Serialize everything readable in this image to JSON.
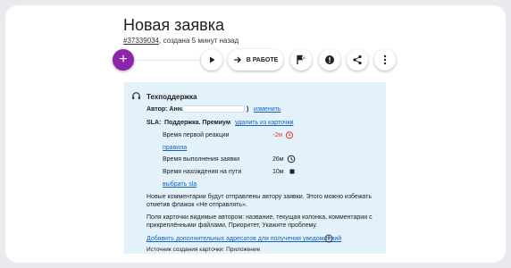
{
  "header": {
    "title": "Новая заявка",
    "ticket_id": "#37339034",
    "created": ", создана 5 минут назад"
  },
  "toolbar": {
    "fab_label": "+",
    "status_label": "В РАБОТЕ",
    "buttons": [
      "play-icon",
      "arrow-right-icon",
      "flag-icon",
      "alert-icon",
      "share-icon",
      "more-vert-icon"
    ]
  },
  "panel": {
    "queue_name": "Техподдержка",
    "author_label": "Автор: Анна (",
    "author_close": ")",
    "change_link": "изменить",
    "sla_label": "SLA:",
    "sla_value": "Поддержка. Премиум",
    "remove_link": "удалить из карточки",
    "metrics": [
      {
        "label": "Время первой реакции",
        "value": "-2м",
        "color": "#e53935",
        "icon": "alarm-icon"
      },
      {
        "label": "Время выполнения заявки",
        "value": "26м",
        "color": "#212121",
        "icon": "clock-icon"
      },
      {
        "label": "Время нахождения на пути",
        "value": "10м",
        "color": "#212121",
        "icon": "stop-icon"
      }
    ],
    "rules_link": "правила",
    "choose_sla_link": "выбрать sla",
    "notice_line1": "Новые комментарии будут отправлены автору заявки. Этого можно избежать",
    "notice_line2": "отметив флажок «Не отправлять».",
    "fields_line1": "Поля карточки видимые автором: название, текущая колонка, комментарии с",
    "fields_line2": "прикреплёнными файлами, Приоритет, Укажите проблему.",
    "add_addresses_link": "Добавить дополнительных адресатов для получения уведомлений",
    "source": "Источник создания карточки: Приложение"
  }
}
